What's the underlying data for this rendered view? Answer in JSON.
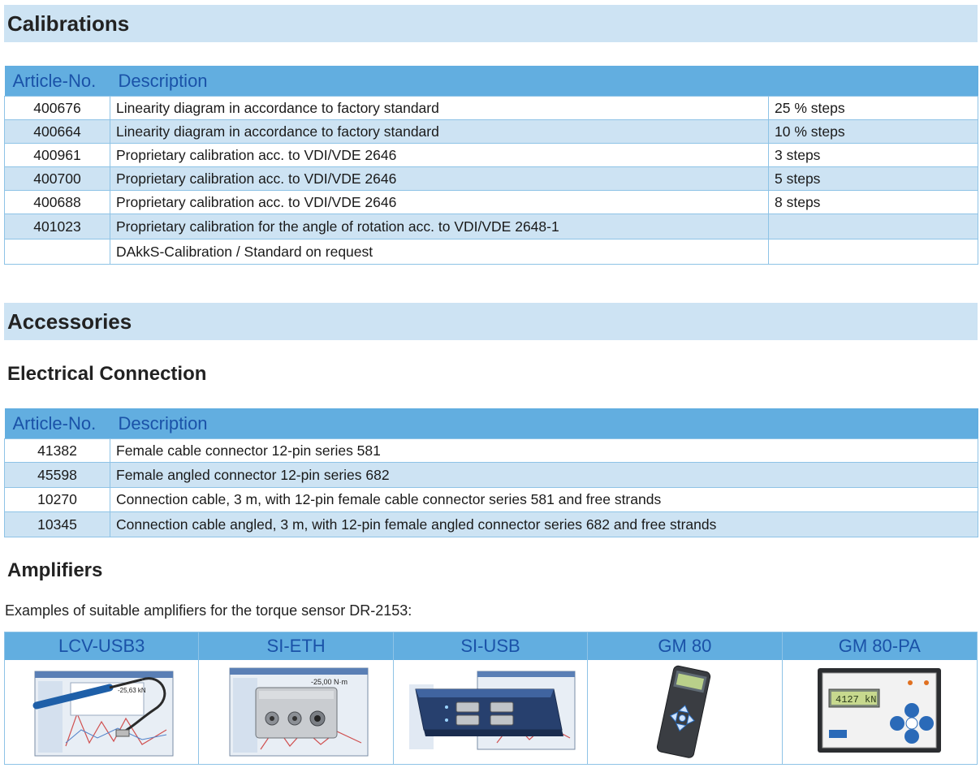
{
  "calibrations": {
    "title": "Calibrations",
    "header": {
      "article": "Article-No.",
      "description": "Description"
    },
    "rows": [
      {
        "article": "400676",
        "description": "Linearity diagram in accordance to factory standard",
        "extra": "25 % steps"
      },
      {
        "article": "400664",
        "description": "Linearity diagram in accordance to factory standard",
        "extra": "10 % steps"
      },
      {
        "article": "400961",
        "description": "Proprietary calibration acc. to VDI/VDE 2646",
        "extra": "3 steps"
      },
      {
        "article": "400700",
        "description": "Proprietary calibration acc. to VDI/VDE 2646",
        "extra": "5 steps"
      },
      {
        "article": "400688",
        "description": "Proprietary calibration acc. to VDI/VDE 2646",
        "extra": "8 steps"
      },
      {
        "article": "401023",
        "description": "Proprietary calibration for the angle of rotation acc. to VDI/VDE 2648-1",
        "extra": ""
      },
      {
        "article": "",
        "description": "DAkkS-Calibration / Standard on request",
        "extra": ""
      }
    ]
  },
  "accessories": {
    "title": "Accessories",
    "electrical": {
      "title": "Electrical Connection",
      "header": {
        "article": "Article-No.",
        "description": "Description"
      },
      "rows": [
        {
          "article": "41382",
          "description": "Female cable connector 12-pin series 581"
        },
        {
          "article": "45598",
          "description": "Female angled connector 12-pin series 682"
        },
        {
          "article": "10270",
          "description": "Connection cable, 3 m, with 12-pin female cable connector series 581 and free strands"
        },
        {
          "article": "10345",
          "description": "Connection cable angled, 3 m, with 12-pin female angled connector series 682 and free strands"
        }
      ]
    },
    "amplifiers": {
      "title": "Amplifiers",
      "intro": "Examples of suitable amplifiers for the torque sensor DR-2153:",
      "items": [
        {
          "name": "LCV-USB3",
          "icon": "lcv-usb3-product-icon",
          "readout": "-25,63 kN"
        },
        {
          "name": "SI-ETH",
          "icon": "si-eth-product-icon",
          "readout": "-25,00 N·m"
        },
        {
          "name": "SI-USB",
          "icon": "si-usb-product-icon",
          "readout": ""
        },
        {
          "name": "GM 80",
          "icon": "gm80-product-icon",
          "readout": ""
        },
        {
          "name": "GM 80-PA",
          "icon": "gm80-pa-product-icon",
          "readout": "4127 kN"
        }
      ]
    }
  },
  "colors": {
    "header_blue": "#62aee0",
    "header_text": "#1a52a8",
    "light_band": "#cde3f3",
    "border": "#8ec3e6"
  }
}
